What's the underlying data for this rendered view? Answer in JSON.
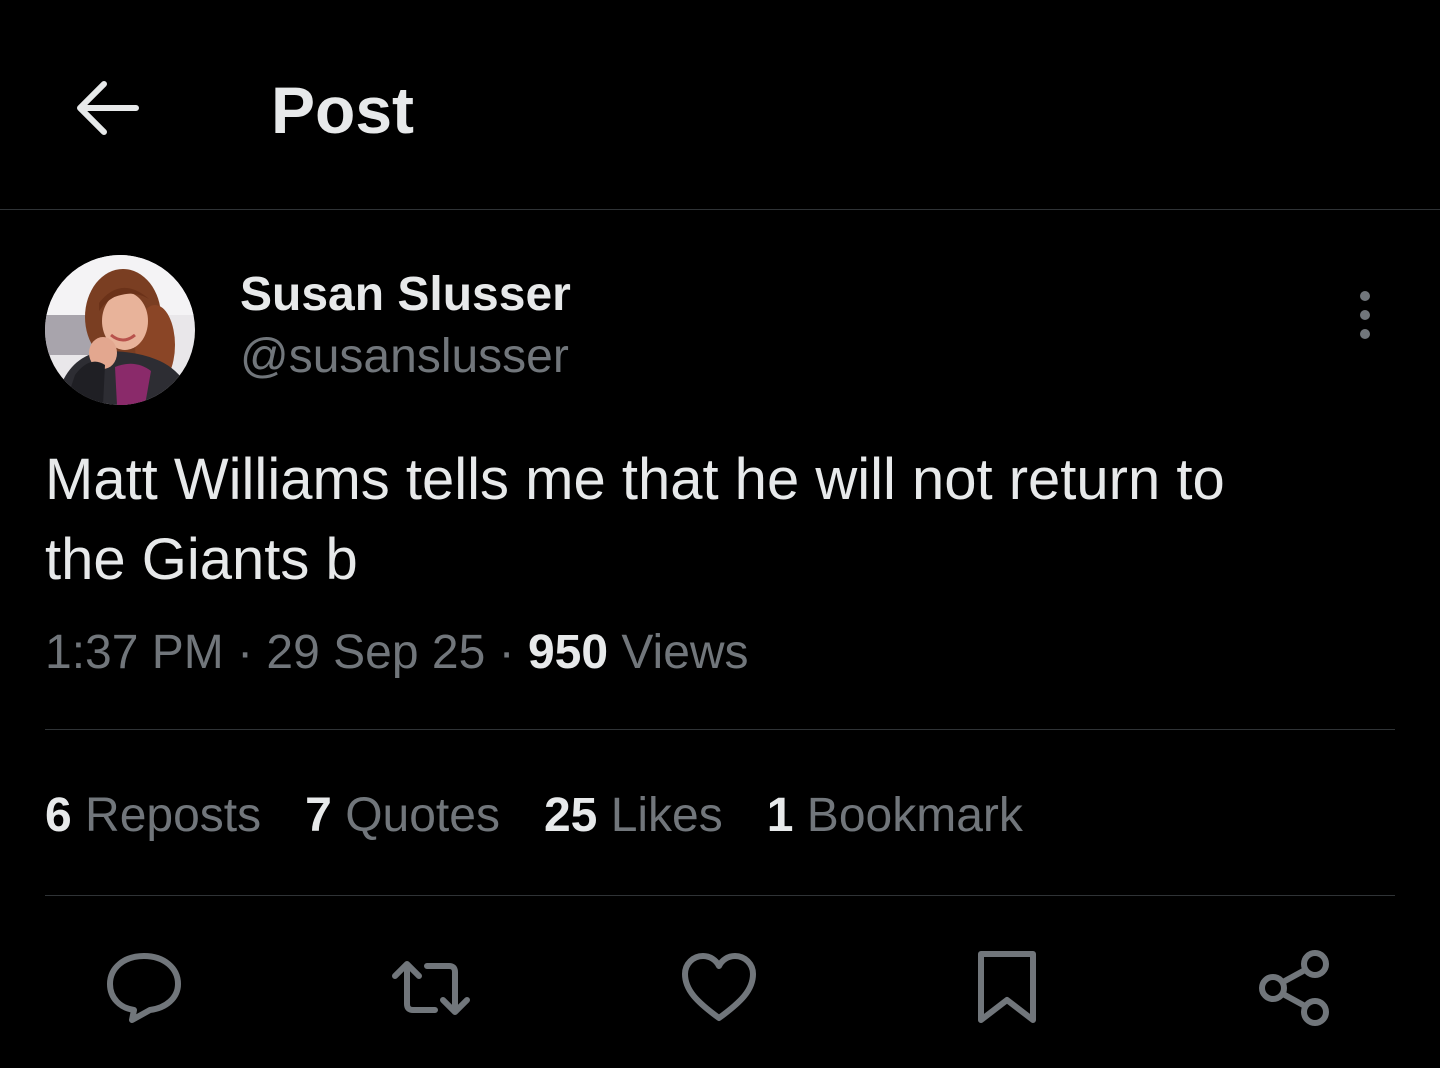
{
  "header": {
    "title": "Post",
    "back_icon": "arrow-left-icon"
  },
  "author": {
    "name": "Susan Slusser",
    "handle": "@susanslusser"
  },
  "post": {
    "text": "Matt Williams tells me that he will not return to\nthe Giants b",
    "time": "1:37 PM",
    "date": "29 Sep 25",
    "views_count": "950",
    "views_label": "Views",
    "sep": " · "
  },
  "stats": {
    "reposts": {
      "count": "6",
      "label": "Reposts"
    },
    "quotes": {
      "count": "7",
      "label": "Quotes"
    },
    "likes": {
      "count": "25",
      "label": "Likes"
    },
    "bookmarks": {
      "count": "1",
      "label": "Bookmark"
    }
  },
  "actions": [
    "reply-icon",
    "repost-icon",
    "like-icon",
    "bookmark-icon",
    "share-icon"
  ],
  "colors": {
    "background": "#000000",
    "text": "#e7e9ea",
    "secondary": "#71767b",
    "divider": "#2f3336"
  }
}
